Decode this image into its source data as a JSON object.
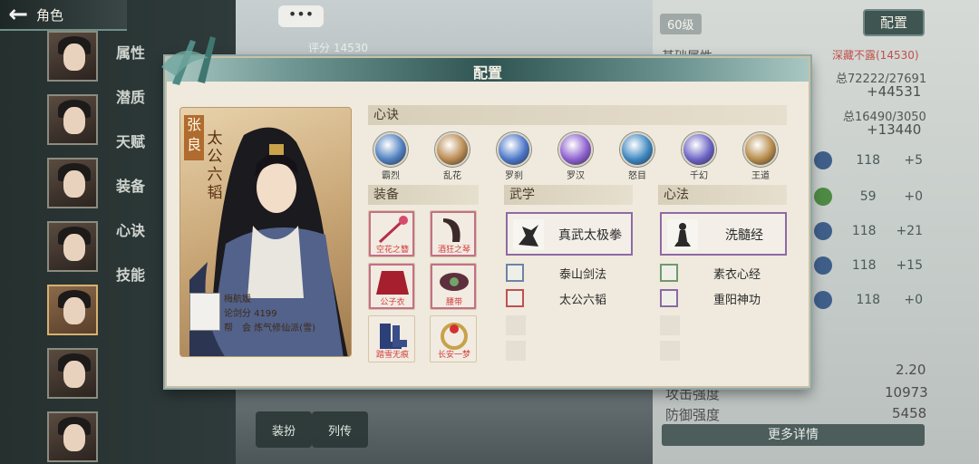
{
  "nav": {
    "back_title": "角色",
    "back_arrow": "←"
  },
  "side_tabs": [
    "属性",
    "潜质",
    "天赋",
    "装备",
    "心诀",
    "技能"
  ],
  "scene": {
    "chat_bubble": "•••",
    "score_top": "评分 14530",
    "bottom_buttons": [
      "装扮",
      "列传"
    ]
  },
  "right_panel": {
    "level": "60级",
    "config_button": "配置",
    "stats_title": "基础属性",
    "hidden_label": "深藏不露(14530)",
    "total_1": "总72222/27691",
    "total_1_plus": "+44531",
    "total_2": "总16490/3050",
    "total_2_plus": "+13440",
    "attr_values": [
      {
        "value": "118",
        "plus": "+5"
      },
      {
        "value": "59",
        "plus": "+0"
      },
      {
        "value": "118",
        "plus": "+21"
      },
      {
        "value": "118",
        "plus": "+15"
      },
      {
        "value": "118",
        "plus": "+0"
      }
    ],
    "row_value": "2.20",
    "attack_label": "攻击强度",
    "attack_value": "10973",
    "defense_label": "防御强度",
    "defense_value": "5458",
    "more_button": "更多详情"
  },
  "modal": {
    "title": "配置",
    "character": {
      "name": "张良",
      "title": "太公六韬",
      "player_name": "梅航媛",
      "player_score": "论剑分 4199",
      "player_guild": "帮　会 炼气修仙派(雪)"
    },
    "xinjue": {
      "header": "心诀",
      "items": [
        {
          "label": "霸烈",
          "color": "#4e7fbf"
        },
        {
          "label": "乱花",
          "color": "#b9894f"
        },
        {
          "label": "罗刹",
          "color": "#4a76c8"
        },
        {
          "label": "罗汉",
          "color": "#8c5fcf"
        },
        {
          "label": "怒目",
          "color": "#3d86c0"
        },
        {
          "label": "千幻",
          "color": "#6b63c5"
        },
        {
          "label": "王道",
          "color": "#b58a48"
        }
      ]
    },
    "equipment": {
      "header": "装备",
      "items": [
        {
          "label": "空花之簪",
          "icon": "hairpin-icon"
        },
        {
          "label": "酒狂之琴",
          "icon": "qin-icon"
        },
        {
          "label": "公子衣",
          "icon": "robe-icon"
        },
        {
          "label": "腰带",
          "icon": "belt-icon"
        },
        {
          "label": "踏雪无痕",
          "icon": "boots-icon"
        },
        {
          "label": "长安一梦",
          "icon": "ring-icon"
        }
      ]
    },
    "wuxue": {
      "header": "武学",
      "main": "真武太极拳",
      "rows": [
        "泰山剑法",
        "太公六韬"
      ]
    },
    "xinfa": {
      "header": "心法",
      "main": "洗髓经",
      "rows": [
        "素衣心经",
        "重阳神功"
      ]
    }
  }
}
